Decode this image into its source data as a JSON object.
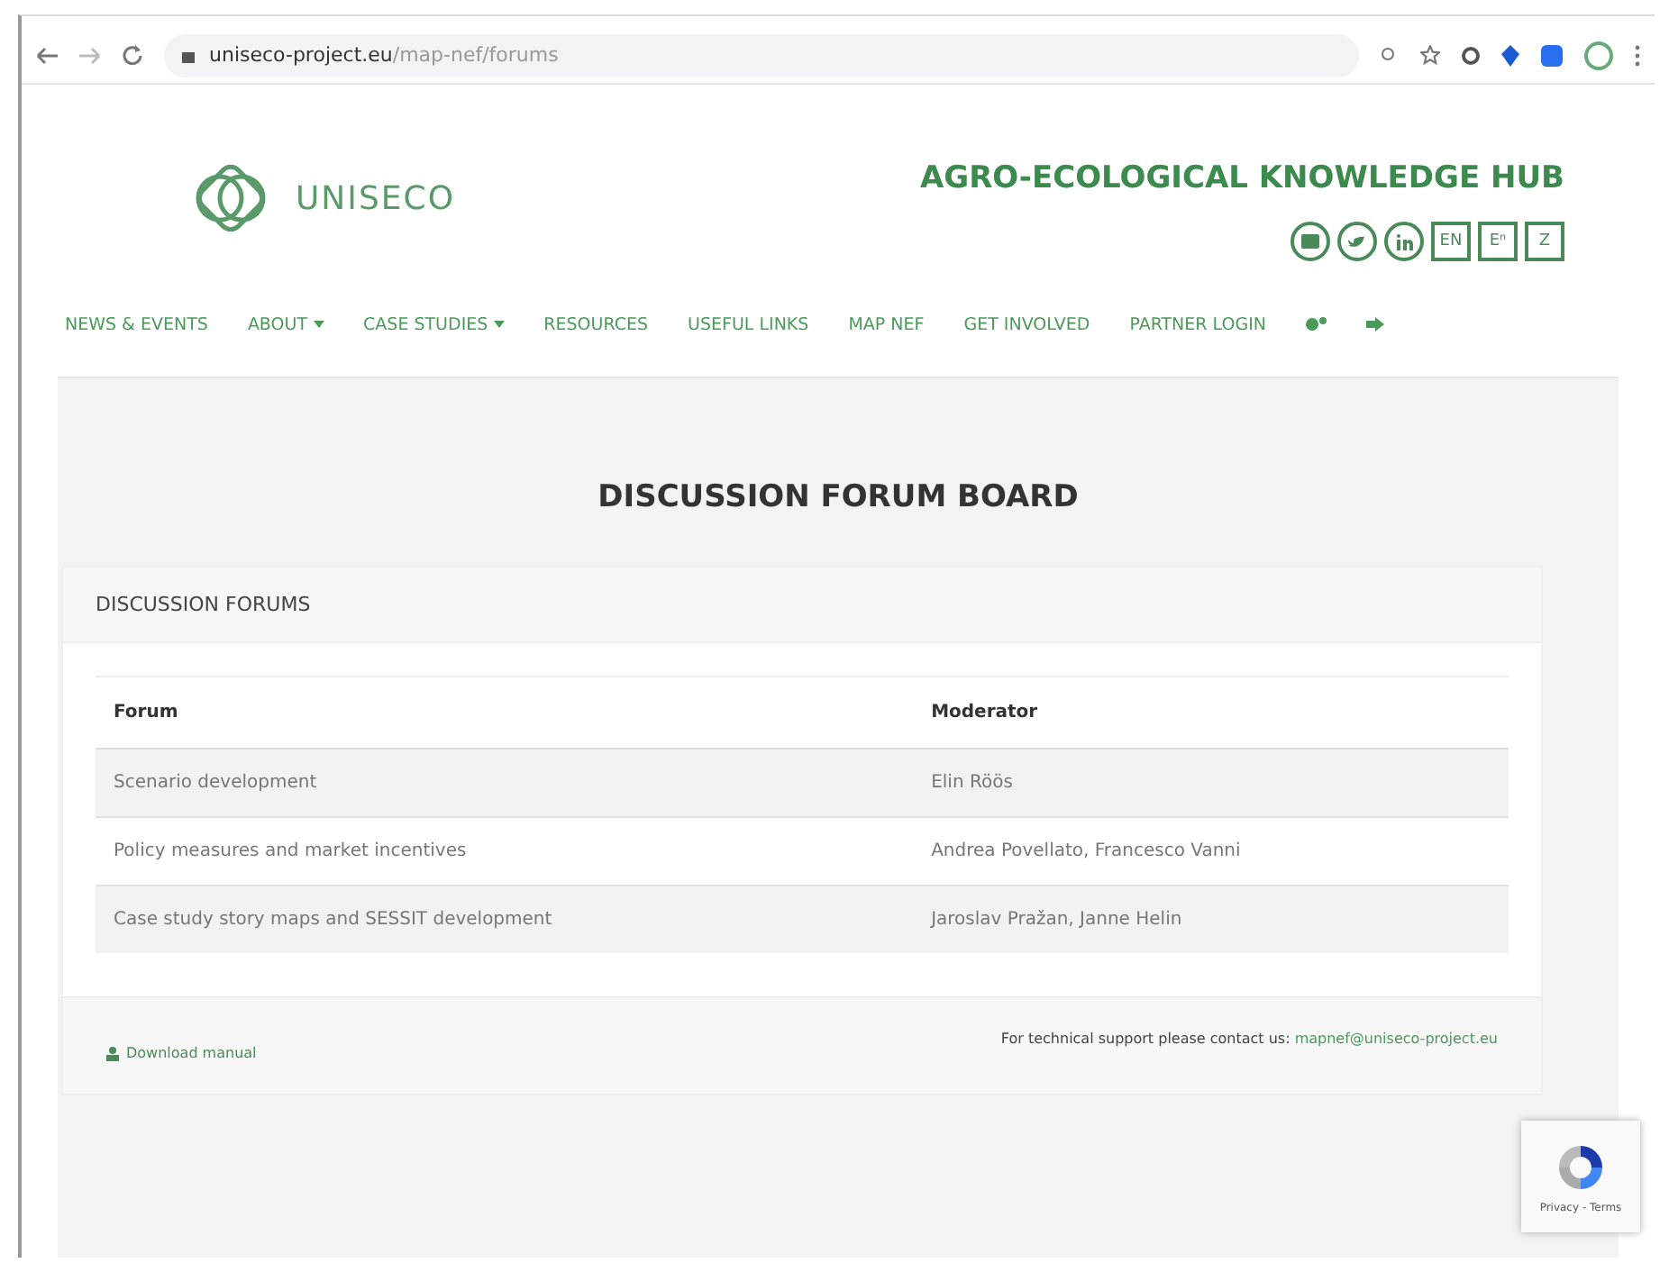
{
  "browser": {
    "url_host": "uniseco-project.eu",
    "url_path": "/map-nef/forums"
  },
  "header": {
    "logo_text": "UNISECO",
    "title": "AGRO-ECOLOGICAL KNOWLEDGE HUB",
    "social": [
      {
        "kind": "email"
      },
      {
        "kind": "twitter"
      },
      {
        "kind": "linkedin"
      }
    ],
    "languages": [
      "EN",
      "Eⁿ",
      "Z"
    ]
  },
  "nav": [
    {
      "label": "NEWS & EVENTS",
      "dropdown": false
    },
    {
      "label": "ABOUT",
      "dropdown": true
    },
    {
      "label": "CASE STUDIES",
      "dropdown": true
    },
    {
      "label": "RESOURCES",
      "dropdown": false
    },
    {
      "label": "USEFUL LINKS",
      "dropdown": false
    },
    {
      "label": "MAP NEF",
      "dropdown": false
    },
    {
      "label": "GET INVOLVED",
      "dropdown": false
    },
    {
      "label": "PARTNER LOGIN",
      "dropdown": false
    }
  ],
  "page_title": "DISCUSSION FORUM BOARD",
  "card": {
    "title": "DISCUSSION FORUMS",
    "columns": [
      "Forum",
      "Moderator"
    ],
    "rows": [
      [
        "Scenario development",
        "Elin Röös"
      ],
      [
        "Policy measures and market incentives",
        "Andrea Povellato, Francesco Vanni"
      ],
      [
        "Case study story maps and SESSIT development",
        "Jaroslav Pražan, Janne Helin"
      ]
    ],
    "download": "Download manual",
    "support": "For technical support please contact us:",
    "support_email": "mapnef@uniseco-project.eu"
  },
  "recaptcha": {
    "links": "Privacy - Terms"
  }
}
